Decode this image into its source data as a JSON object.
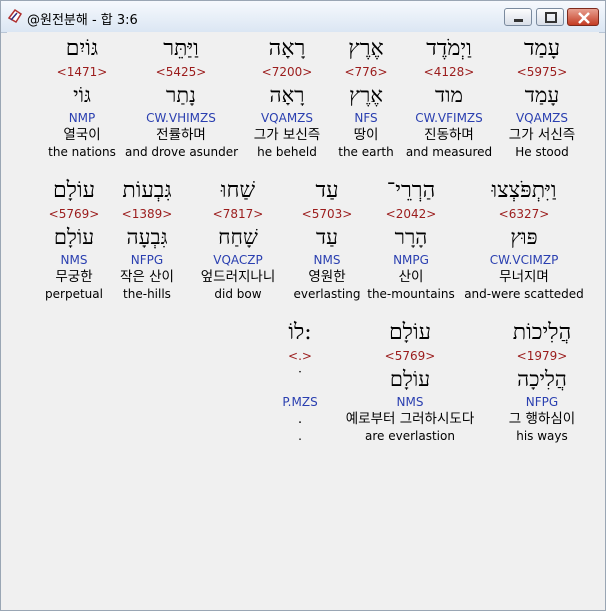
{
  "window": {
    "title": "@원전분해 - 합 3:6"
  },
  "rows": [
    [
      {
        "heb": "עָמַד",
        "strong": "<5975>",
        "lemma": "עָמַד",
        "parse": "VQAMZS",
        "kor": "그가 서신즉",
        "eng": "He stood",
        "hl": true
      },
      {
        "heb": "וַיְמֹדֶד",
        "strong": "<4128>",
        "lemma": "מוד",
        "parse": "CW.VFIMZS",
        "kor": "진동하며",
        "eng": "and measured"
      },
      {
        "heb": "אֶרֶץ",
        "strong": "<776>",
        "lemma": "אֶרֶץ",
        "parse": "NFS",
        "kor": "땅이",
        "eng": "the earth"
      },
      {
        "heb": "רָאָה",
        "strong": "<7200>",
        "lemma": "רָאָה",
        "parse": "VQAMZS",
        "kor": "그가 보신즉",
        "eng": "he beheld"
      },
      {
        "heb": "וַיַּתֵּר",
        "strong": "<5425>",
        "lemma": "נָתַר",
        "parse": "CW.VHIMZS",
        "kor": "전률하며",
        "eng": "and drove asunder"
      },
      {
        "heb": "גּוֹיִם",
        "strong": "<1471>",
        "lemma": "גּוֹי",
        "parse": "NMP",
        "kor": "열국이",
        "eng": "the nations"
      }
    ],
    [
      {
        "heb": "וַיִּתְפֹּצְצוּ",
        "strong": "<6327>",
        "lemma": "פּוּץ",
        "parse": "CW.VCIMZP",
        "kor": "무너지며",
        "eng": "and-were scatteded"
      },
      {
        "heb": "הַרְרֵי־",
        "strong": "<2042>",
        "lemma": "הָרָר",
        "parse": "NMPG",
        "kor": "산이",
        "eng": "the-mountains"
      },
      {
        "heb": "עַד",
        "strong": "<5703>",
        "lemma": "עַד",
        "parse": "NMS",
        "kor": "영원한",
        "eng": "everlasting"
      },
      {
        "heb": "שַׁחוּ",
        "strong": "<7817>",
        "lemma": "שָׁחַח",
        "parse": "VQACZP",
        "kor": "엎드러지나니",
        "eng": "did bow"
      },
      {
        "heb": "גִּבְעוֹת",
        "strong": "<1389>",
        "lemma": "גִּבְעָה",
        "parse": "NFPG",
        "kor": "작은 산이",
        "eng": "the-hills"
      },
      {
        "heb": "עוֹלָם",
        "strong": "<5769>",
        "lemma": "עוֹלָם",
        "parse": "NMS",
        "kor": "무궁한",
        "eng": "perpetual"
      }
    ],
    [
      {
        "heb": "הֲלִיכוֹת",
        "strong": "<1979>",
        "lemma": "הֲלִיכָה",
        "parse": "NFPG",
        "kor": "그 행하심이",
        "eng": "his ways"
      },
      {
        "heb": "עוֹלָם",
        "strong": "<5769>",
        "lemma": "עוֹלָם",
        "parse": "NMS",
        "kor": "예로부터 그러하시도다",
        "eng": "are everlastion"
      },
      {
        "heb": "לוֹ:",
        "strong": "<.>",
        "lemma": "ׁ",
        "parse": "P.MZS",
        "kor": ".",
        "eng": "."
      }
    ]
  ]
}
